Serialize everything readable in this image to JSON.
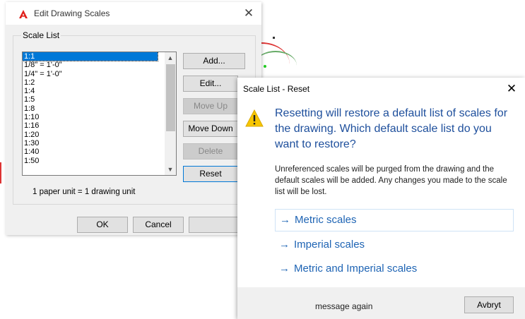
{
  "colors": {
    "accent": "#0078d7",
    "link": "#1e64b4",
    "heading": "#1e4f9c",
    "warning": "#f7c600"
  },
  "edit_dialog": {
    "title": "Edit Drawing Scales",
    "logo_icon": "autocad-logo",
    "group_label": "Scale List",
    "scales": [
      "1:1",
      "1/8\" = 1'-0\"",
      "1/4\" = 1'-0\"",
      "1:2",
      "1:4",
      "1:5",
      "1:8",
      "1:10",
      "1:16",
      "1:20",
      "1:30",
      "1:40",
      "1:50"
    ],
    "selected_scale": "1:1",
    "buttons": {
      "add": "Add...",
      "edit": "Edit...",
      "move_up": "Move Up",
      "move_down": "Move Down",
      "delete": "Delete",
      "reset": "Reset"
    },
    "unit_text": "1 paper unit = 1 drawing unit",
    "ok": "OK",
    "cancel": "Cancel"
  },
  "reset_dialog": {
    "title": "Scale List - Reset",
    "heading": "Resetting will restore a default list of scales for the drawing. Which default scale list do you want to restore?",
    "body": "Unreferenced scales will be purged from the drawing and the default scales will be added. Any changes you made to the scale list will be lost.",
    "options": [
      "Metric scales",
      "Imperial scales",
      "Metric and Imperial scales"
    ],
    "arrow": "→",
    "footer_text": "message again",
    "cancel": "Avbryt"
  }
}
